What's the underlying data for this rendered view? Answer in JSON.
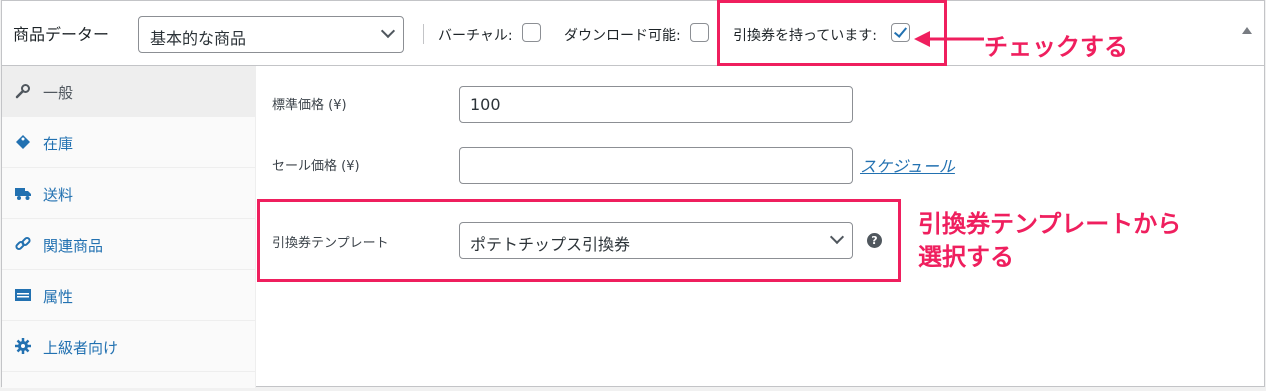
{
  "header": {
    "title": "商品データー",
    "product_type": "基本的な商品",
    "options": [
      {
        "label": "バーチャル:",
        "checked": false
      },
      {
        "label": "ダウンロード可能:",
        "checked": false
      },
      {
        "label": "引換券を持っています:",
        "checked": true
      }
    ]
  },
  "tabs": [
    {
      "label": "一般",
      "icon": "wrench-icon",
      "active": true
    },
    {
      "label": "在庫",
      "icon": "tag-icon",
      "active": false
    },
    {
      "label": "送料",
      "icon": "truck-icon",
      "active": false
    },
    {
      "label": "関連商品",
      "icon": "link-icon",
      "active": false
    },
    {
      "label": "属性",
      "icon": "list-icon",
      "active": false
    },
    {
      "label": "上級者向け",
      "icon": "gear-icon",
      "active": false
    }
  ],
  "fields": {
    "regular_price": {
      "label": "標準価格 (¥)",
      "value": "100"
    },
    "sale_price": {
      "label": "セール価格 (¥)",
      "value": "",
      "schedule_link": "スケジュール"
    },
    "voucher_template": {
      "label": "引換券テンプレート",
      "value": "ポテトチップス引換券",
      "help": "?"
    }
  },
  "annotations": {
    "check": "チェックする",
    "select_line1": "引換券テンプレートから",
    "select_line2": "選択する",
    "color": "#ef1f5e"
  }
}
